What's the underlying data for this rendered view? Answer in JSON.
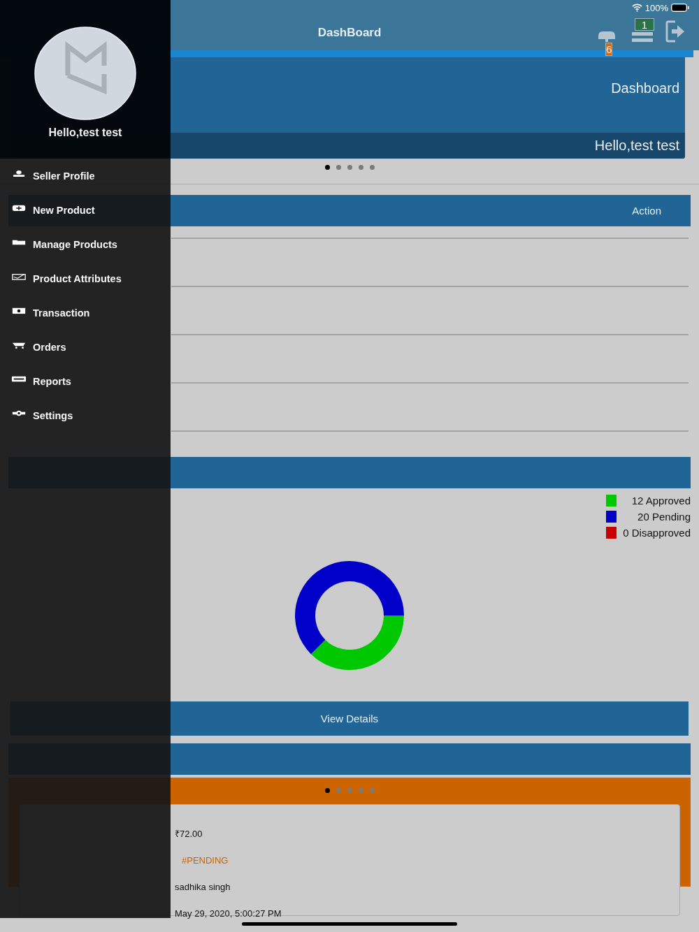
{
  "status_bar": {
    "battery": "100%"
  },
  "header": {
    "title": "DashBoard",
    "notifications_badge": "6",
    "orders_badge": "1"
  },
  "banner": {
    "title": "Dashboard",
    "greeting": "Hello,test test",
    "pager": [
      {
        "selected": true
      },
      {
        "selected": false
      },
      {
        "selected": false
      },
      {
        "selected": false
      },
      {
        "selected": false
      }
    ]
  },
  "sales_analytics": {
    "action": "Action"
  },
  "products_status": {
    "legend": [
      {
        "label": "12 Approved",
        "color": "#00c800"
      },
      {
        "label": "20 Pending",
        "color": "#0000c8"
      },
      {
        "label": "0 Disapproved",
        "color": "#c80000"
      }
    ],
    "chart_data": {
      "type": "donut",
      "values": [
        37.5,
        62.5,
        0
      ]
    }
  },
  "view_details": "View Details",
  "latest_orders": {
    "pager": [
      {
        "selected": true
      },
      {
        "selected": false
      },
      {
        "selected": false
      },
      {
        "selected": false
      },
      {
        "selected": false
      }
    ],
    "values": [
      {
        "value": "₹72.00",
        "kind": "plain"
      },
      {
        "value": "#PENDING",
        "kind": "status"
      },
      {
        "value": "sadhika singh",
        "kind": "plain"
      },
      {
        "value": "May 29, 2020, 5:00:27 PM",
        "kind": "plain"
      }
    ]
  },
  "drawer": {
    "greeting": "Hello,test test",
    "items": [
      {
        "label": "Seller Profile",
        "kind": "profile"
      },
      {
        "label": "New Product",
        "kind": "add"
      },
      {
        "label": "Manage Products",
        "kind": "folder"
      },
      {
        "label": "Product Attributes",
        "kind": "tag"
      },
      {
        "label": "Transaction",
        "kind": "money"
      },
      {
        "label": "Orders",
        "kind": "cart"
      },
      {
        "label": "Reports",
        "kind": "report"
      },
      {
        "label": "Settings",
        "kind": "gear"
      }
    ]
  }
}
